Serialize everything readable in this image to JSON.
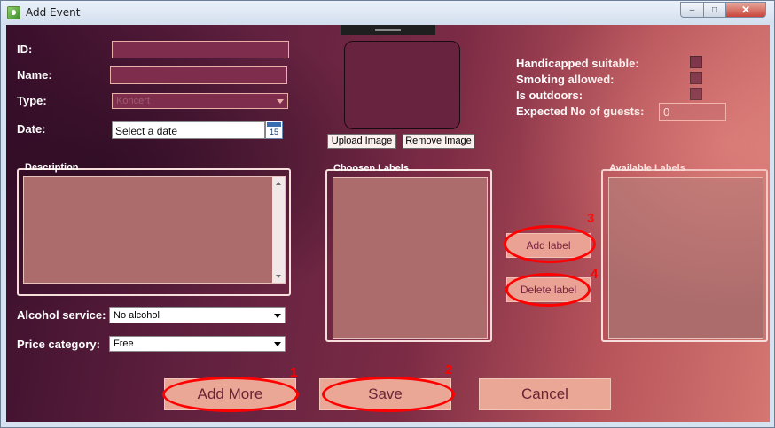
{
  "window": {
    "title": "Add Event",
    "minimize_glyph": "‒",
    "maximize_glyph": "□",
    "close_glyph": "✕"
  },
  "fields": {
    "id_label": "ID:",
    "name_label": "Name:",
    "type_label": "Type:",
    "type_value": "Koncert",
    "date_label": "Date:",
    "date_placeholder": "Select a date",
    "calendar_day": "15"
  },
  "image": {
    "upload_label": "Upload Image",
    "remove_label": "Remove Image"
  },
  "options": {
    "handicapped_label": "Handicapped suitable:",
    "smoking_label": "Smoking allowed:",
    "outdoors_label": "Is outdoors:",
    "guests_label": "Expected No of guests:",
    "guests_value": "0"
  },
  "description": {
    "title": "Description"
  },
  "alcohol": {
    "label": "Alcohol service:",
    "value": "No alcohol"
  },
  "price": {
    "label": "Price category:",
    "value": "Free"
  },
  "labels": {
    "chosen_title": "Choosen Labels",
    "available_title": "Available Labels",
    "add_label": "Add label",
    "delete_label": "Delete label"
  },
  "actions": {
    "add_more": "Add More",
    "save": "Save",
    "cancel": "Cancel"
  },
  "annotations": {
    "one": "1",
    "two": "2",
    "three": "3",
    "four": "4",
    "color": "#ff0000"
  },
  "colors": {
    "accent_red": "#ff0000",
    "button_pink": "#eaa796",
    "field_dark": "#7e2e4c"
  }
}
